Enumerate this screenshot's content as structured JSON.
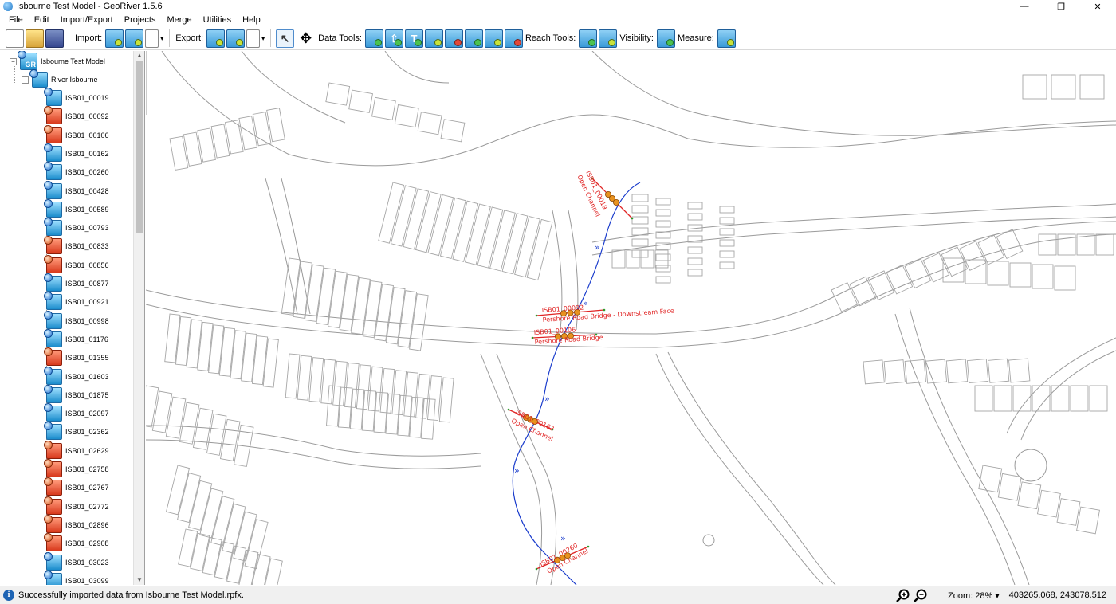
{
  "window": {
    "title": "Isbourne Test Model - GeoRiver 1.5.6"
  },
  "menu": [
    "File",
    "Edit",
    "Import/Export",
    "Projects",
    "Merge",
    "Utilities",
    "Help"
  ],
  "toolbar": {
    "import_label": "Import:",
    "export_label": "Export:",
    "data_tools_label": "Data Tools:",
    "reach_tools_label": "Reach Tools:",
    "visibility_label": "Visibility:",
    "measure_label": "Measure:"
  },
  "tree": {
    "root": "Isbourne Test Model",
    "root_badge": "GR",
    "river": "River Isbourne",
    "nodes": [
      {
        "label": "ISB01_00019",
        "type": "channel"
      },
      {
        "label": "ISB01_00092",
        "type": "bridge"
      },
      {
        "label": "ISB01_00106",
        "type": "bridge"
      },
      {
        "label": "ISB01_00162",
        "type": "channel"
      },
      {
        "label": "ISB01_00260",
        "type": "channel"
      },
      {
        "label": "ISB01_00428",
        "type": "channel"
      },
      {
        "label": "ISB01_00589",
        "type": "channel"
      },
      {
        "label": "ISB01_00793",
        "type": "channel"
      },
      {
        "label": "ISB01_00833",
        "type": "bridge"
      },
      {
        "label": "ISB01_00856",
        "type": "bridge"
      },
      {
        "label": "ISB01_00877",
        "type": "channel"
      },
      {
        "label": "ISB01_00921",
        "type": "channel"
      },
      {
        "label": "ISB01_00998",
        "type": "channel"
      },
      {
        "label": "ISB01_01176",
        "type": "channel"
      },
      {
        "label": "ISB01_01355",
        "type": "bridge"
      },
      {
        "label": "ISB01_01603",
        "type": "channel"
      },
      {
        "label": "ISB01_01875",
        "type": "channel"
      },
      {
        "label": "ISB01_02097",
        "type": "channel"
      },
      {
        "label": "ISB01_02362",
        "type": "channel"
      },
      {
        "label": "ISB01_02629",
        "type": "bridge"
      },
      {
        "label": "ISB01_02758",
        "type": "bridge"
      },
      {
        "label": "ISB01_02767",
        "type": "bridge"
      },
      {
        "label": "ISB01_02772",
        "type": "bridge"
      },
      {
        "label": "ISB01_02896",
        "type": "bridge"
      },
      {
        "label": "ISB01_02908",
        "type": "bridge"
      },
      {
        "label": "ISB01_03023",
        "type": "channel"
      },
      {
        "label": "ISB01_03099",
        "type": "channel"
      }
    ]
  },
  "map": {
    "cross_sections": [
      {
        "id": "ISB01_00019",
        "desc": "Open Channel"
      },
      {
        "id": "ISB01_00092",
        "desc": "Pershore Road Bridge - Downstream Face"
      },
      {
        "id": "ISB01_00106",
        "desc": "Pershore Road Bridge"
      },
      {
        "id": "ISB01_00162",
        "desc": "Open Channel"
      },
      {
        "id": "ISB01_00260",
        "desc": "Open Channel"
      }
    ],
    "colors": {
      "river": "#1a3ccc",
      "section": "#e02424",
      "basemap": "#9a9a9a",
      "node": "#e8921e"
    }
  },
  "status": {
    "message": "Successfully imported data from Isbourne Test Model.rpfx.",
    "zoom": "Zoom: 28% ▾",
    "coords": "403265.068, 243078.512"
  }
}
